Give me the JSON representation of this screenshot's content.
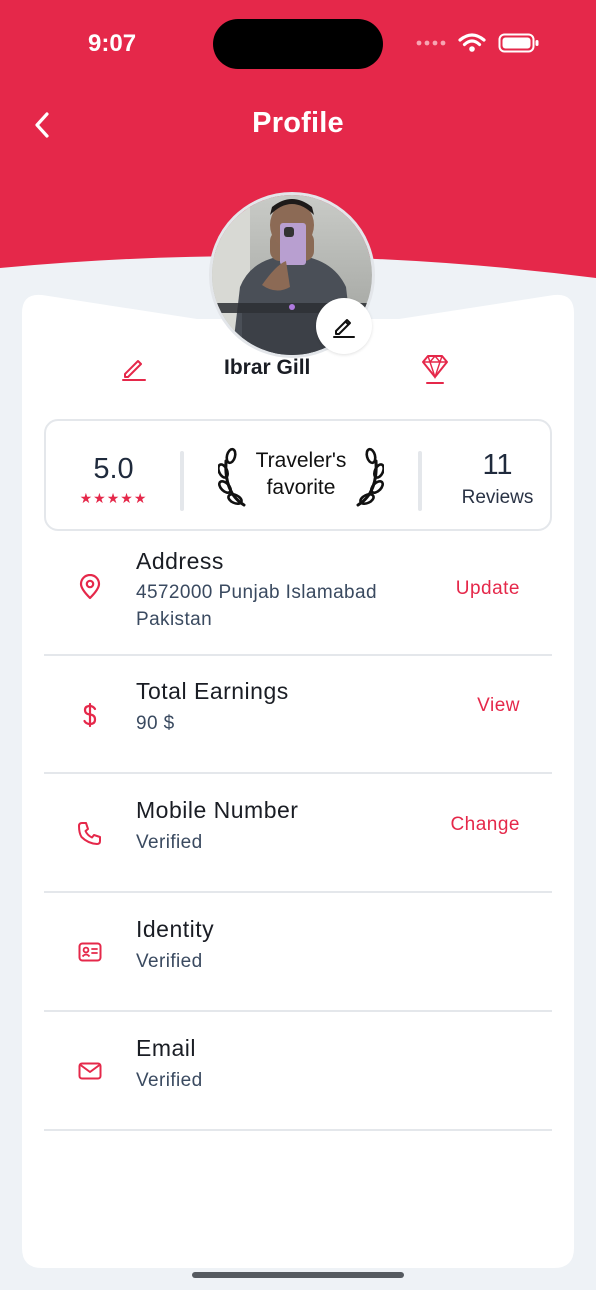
{
  "status_bar": {
    "time": "9:07"
  },
  "nav": {
    "title": "Profile"
  },
  "profile": {
    "name": "Ibrar Gill"
  },
  "stats": {
    "rating": "5.0",
    "stars": "★★★★★",
    "badge_line1": "Traveler's",
    "badge_line2": "favorite",
    "reviews_count": "11",
    "reviews_label": "Reviews"
  },
  "rows": [
    {
      "title": "Address",
      "subtitle": "4572000 Punjab Islamabad Pakistan",
      "action": "Update",
      "icon": "location-pin-icon"
    },
    {
      "title": "Total Earnings",
      "subtitle": "90 $",
      "action": "View",
      "icon": "dollar-icon"
    },
    {
      "title": "Mobile Number",
      "subtitle": "Verified",
      "action": "Change",
      "icon": "phone-icon"
    },
    {
      "title": "Identity",
      "subtitle": "Verified",
      "action": "",
      "icon": "id-card-icon"
    },
    {
      "title": "Email",
      "subtitle": "Verified",
      "action": "",
      "icon": "mail-icon"
    }
  ],
  "colors": {
    "accent": "#E5284A",
    "background": "#EEF2F6",
    "card": "#FFFFFF"
  }
}
